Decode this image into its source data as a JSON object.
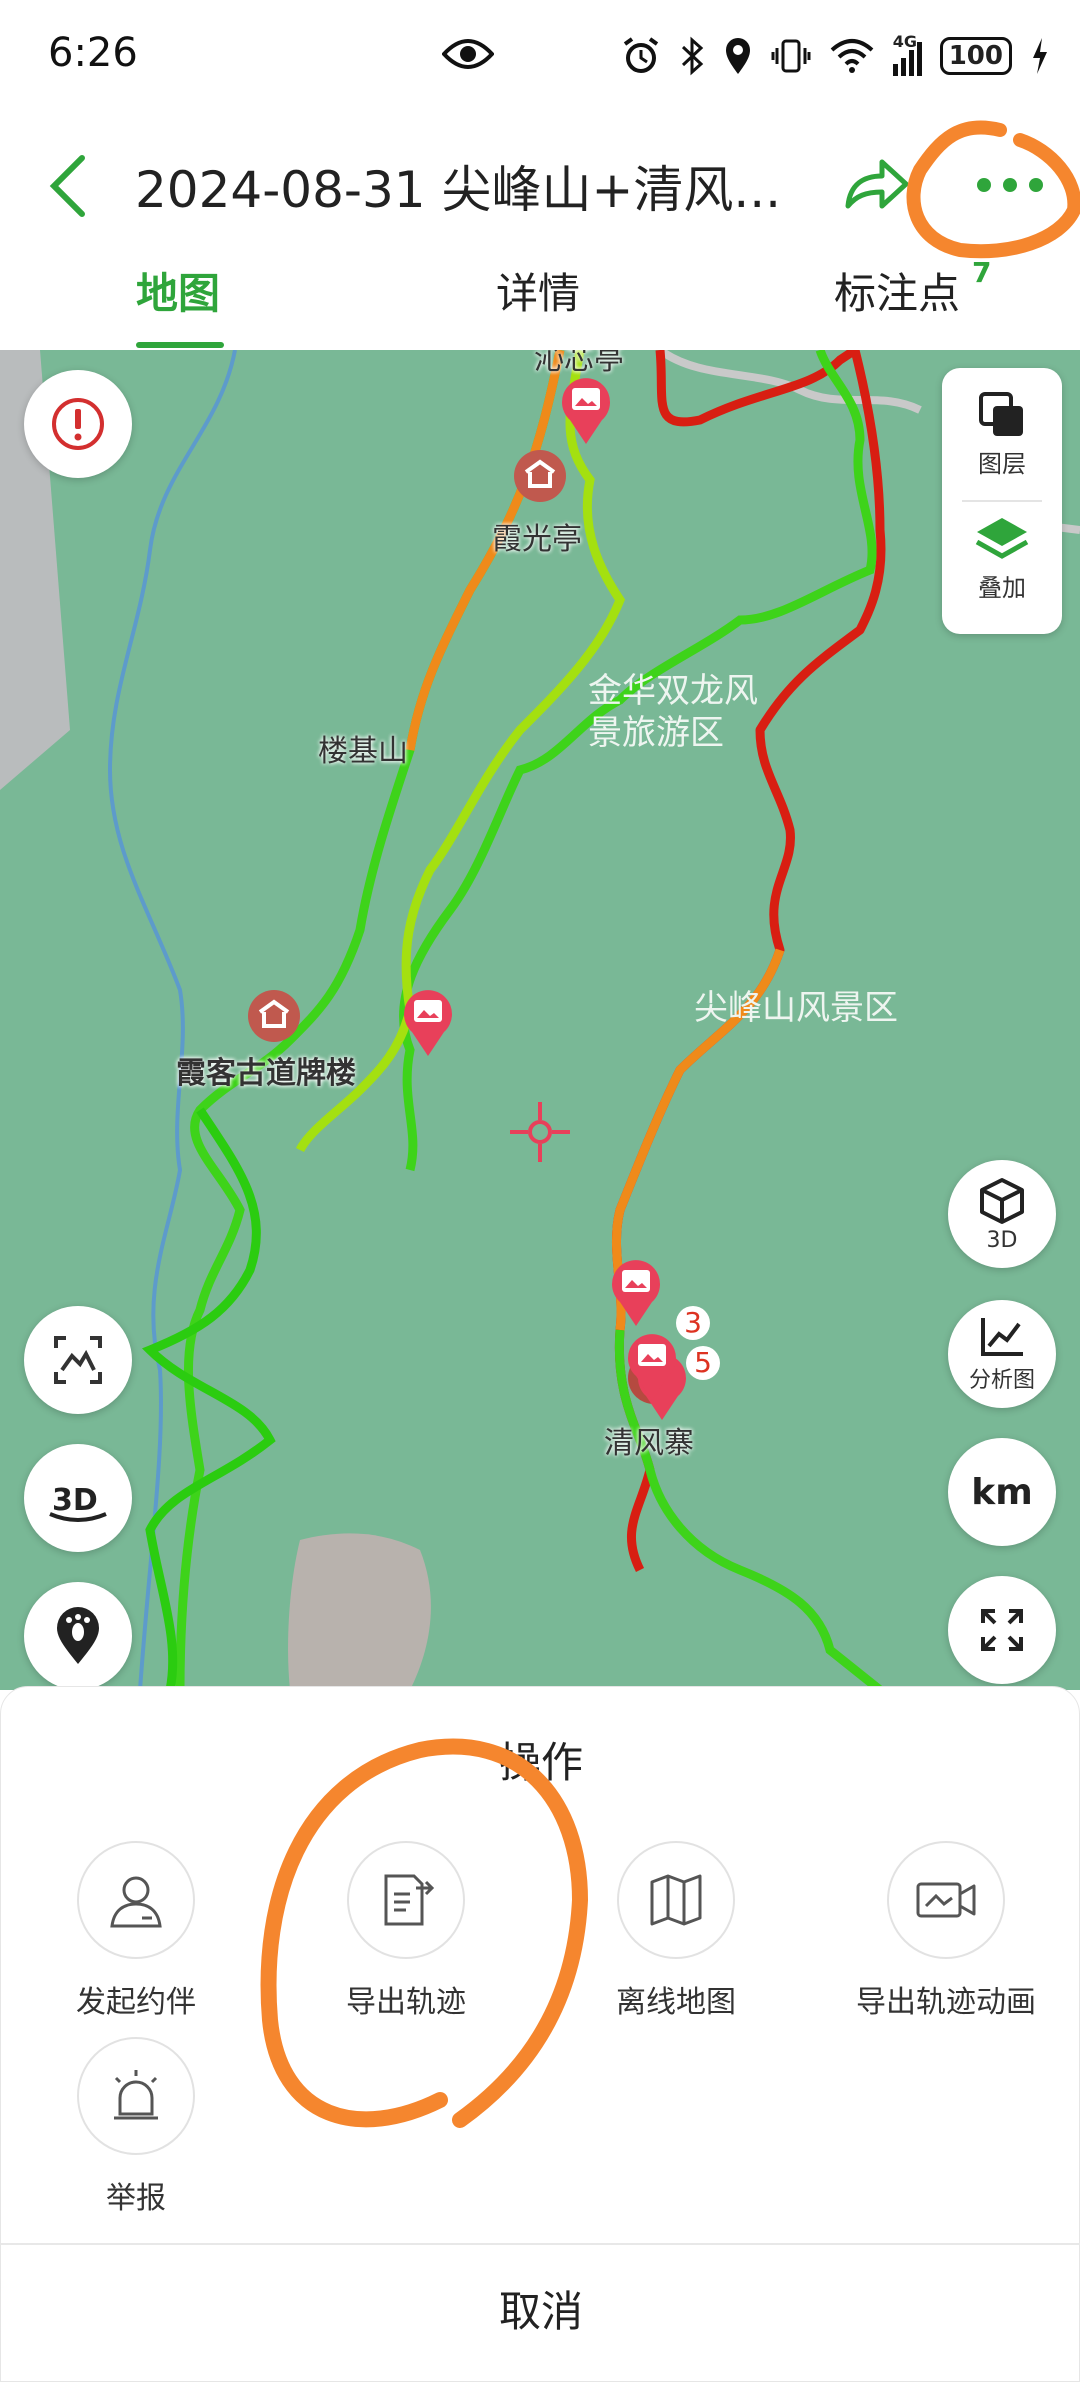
{
  "status_bar": {
    "time": "6:26",
    "battery": "100",
    "network": "4G"
  },
  "header": {
    "title": "2024-08-31 尖峰山+清风...",
    "tabs": [
      {
        "label": "地图",
        "active": true
      },
      {
        "label": "详情",
        "active": false
      },
      {
        "label": "标注点",
        "active": false,
        "badge": "7"
      }
    ]
  },
  "map": {
    "labels": {
      "pavilion_top": "沁芯亭",
      "xiaguang_pavilion": "霞光亭",
      "louji_mountain": "楼基山",
      "jinhua_area": "金华双龙风景旅游区",
      "jianfeng_area": "尖峰山风景区",
      "xiake_gate": "霞客古道牌楼",
      "qingfeng_village": "清风寨"
    },
    "cluster_counts": [
      "3",
      "5"
    ],
    "layer_panel": {
      "layers_label": "图层",
      "overlay_label": "叠加"
    },
    "right_buttons": {
      "threed_label": "3D",
      "analysis_label": "分析图",
      "km_label": "km"
    },
    "colors": {
      "map_bg": "#79b896",
      "route_green": "#3ed31a",
      "route_red": "#d81e12",
      "route_orange": "#ef8a1a",
      "accent": "#2fa53b",
      "annotation": "#f5862e"
    }
  },
  "sheet": {
    "title": "操作",
    "actions": [
      {
        "label": "发起约伴",
        "icon": "person-icon"
      },
      {
        "label": "导出轨迹",
        "icon": "export-document-icon"
      },
      {
        "label": "离线地图",
        "icon": "map-icon"
      },
      {
        "label": "导出轨迹动画",
        "icon": "video-icon"
      },
      {
        "label": "举报",
        "icon": "alarm-icon"
      }
    ],
    "cancel_label": "取消"
  }
}
